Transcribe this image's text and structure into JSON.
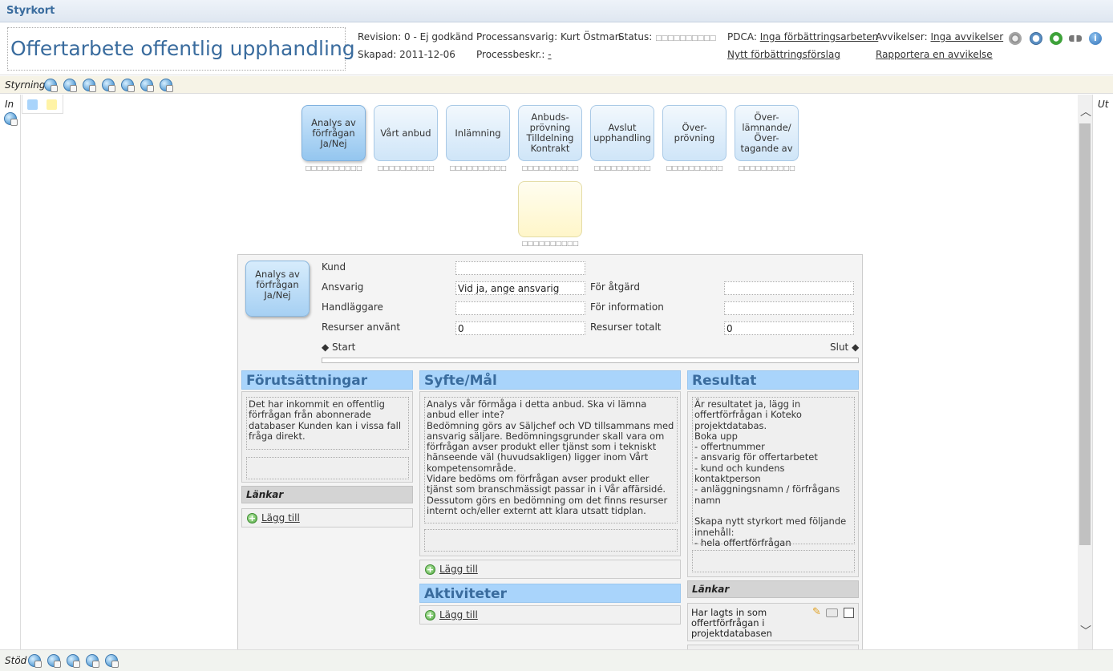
{
  "window": {
    "title": "Styrkort"
  },
  "header": {
    "process_title": "Offertarbete offentlig upphandling",
    "revision_label": "Revision:",
    "revision_value": "0 - Ej godkänd",
    "created_label": "Skapad:",
    "created_value": "2011-12-06",
    "owner_label": "Processansvarig:",
    "owner_value": "Kurt Östman",
    "desc_label": "Processbeskr.:",
    "desc_value": "-",
    "status_label": "Status:",
    "status_value": "□□□□□□□□□□",
    "pdca_label": "PDCA:",
    "pdca_link": "Inga förbättringsarbeten",
    "pdca_new_link": "Nytt förbättringsförslag",
    "dev_label": "Avvikelser:",
    "dev_link": "Inga avvikelser",
    "dev_report_link": "Rapportera en avvikelse",
    "icons": [
      "gear-icon",
      "clock-icon",
      "refresh-icon",
      "unlink-icon",
      "info-icon"
    ]
  },
  "bars": {
    "styrning": "Styrning",
    "in": "In",
    "ut": "Ut",
    "stod": "Stöd"
  },
  "steps": [
    {
      "label": "Analys av förfrågan Ja/Nej",
      "dots": "□□□□□□□□□□"
    },
    {
      "label": "Vårt anbud",
      "dots": "□□□□□□□□□□"
    },
    {
      "label": "Inlämning",
      "dots": "□□□□□□□□□□"
    },
    {
      "label": "Anbuds-prövning Tilldelning Kontrakt",
      "dots": "□□□□□□□□□□"
    },
    {
      "label": "Avslut upphandling",
      "dots": "□□□□□□□□□□"
    },
    {
      "label": "Över-prövning",
      "dots": "□□□□□□□□□□"
    },
    {
      "label": "Över-lämnande/ Över-tagande av",
      "dots": "□□□□□□□□□□"
    }
  ],
  "yellow_step_dots": "□□□□□□□□□□",
  "detail": {
    "step_label": "Analys av förfrågan Ja/Nej",
    "kund_label": "Kund",
    "kund_value": "",
    "ansvarig_label": "Ansvarig",
    "ansvarig_value": "Vid ja, ange ansvarig",
    "handlaggare_label": "Handläggare",
    "handlaggare_value": "",
    "resurser_anvant_label": "Resurser använt",
    "resurser_anvant_value": "0",
    "for_atgard_label": "För åtgärd",
    "for_atgard_value": "",
    "for_information_label": "För information",
    "for_information_value": "",
    "resurser_totalt_label": "Resurser totalt",
    "resurser_totalt_value": "0",
    "start_label": "◆ Start",
    "slut_label": "Slut ◆"
  },
  "panels": {
    "forutsattningar": {
      "title": "Förutsättningar",
      "text": "Det har inkommit en offentlig förfrågan från abonnerade databaser Kunden kan i vissa fall fråga direkt.",
      "links_title": "Länkar",
      "add_label": "Lägg till"
    },
    "syfte": {
      "title": "Syfte/Mål",
      "text": "Analys vår förmåga i detta anbud. Ska vi lämna anbud eller inte?\nBedömning görs av Säljchef och VD tillsammans med ansvarig säljare. Bedömningsgrunder skall vara om förfrågan avser produkt eller tjänst som i tekniskt hänseende väl (huvudsakligen) ligger inom Vårt kompetensområde.\nVidare bedöms om förfrågan avser produkt eller tjänst som branschmässigt passar in i Vår affärsidé.\nDessutom görs en bedömning om det finns resurser internt och/eller externt att klara utsatt tidplan.",
      "add_label": "Lägg till"
    },
    "aktiviteter": {
      "title": "Aktiviteter",
      "add_label": "Lägg till"
    },
    "resultat": {
      "title": "Resultat",
      "text": "Är resultatet ja, lägg in offertförfrågan i Koteko projektdatabas.\nBoka upp\n- offertnummer\n- ansvarig för offertarbetet\n- kund och kundens kontaktperson\n- anläggningsnamn / förfrågans namn\n\nSkapa nytt styrkort med följande innehåll:\n- hela offertförfrågan",
      "links_title": "Länkar",
      "link_item": "Har lagts in som offertförfrågan i projektdatabasen"
    }
  },
  "colors": {
    "accent": "#3a6c9e",
    "panel_header": "#a9d4fb",
    "step_blue": "#cfe5f8",
    "step_yellow": "#fff6c9"
  }
}
